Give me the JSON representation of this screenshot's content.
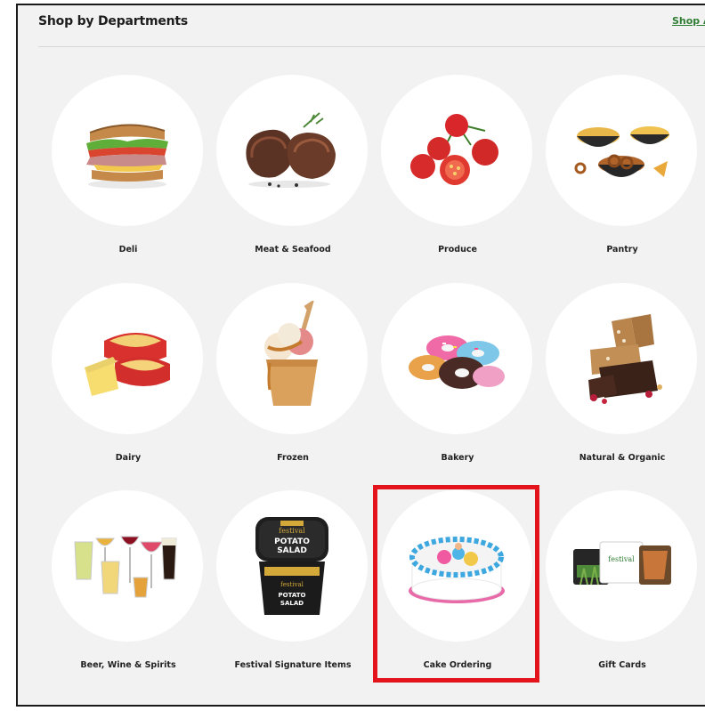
{
  "header": {
    "title": "Shop by Departments",
    "shop_all": "Shop All"
  },
  "departments": [
    {
      "label": "Deli",
      "icon": "sandwich-icon"
    },
    {
      "label": "Meat & Seafood",
      "icon": "steak-icon"
    },
    {
      "label": "Produce",
      "icon": "tomatoes-icon"
    },
    {
      "label": "Pantry",
      "icon": "snacks-icon"
    },
    {
      "label": "Dairy",
      "icon": "cheese-icon"
    },
    {
      "label": "Frozen",
      "icon": "ice-cream-icon"
    },
    {
      "label": "Bakery",
      "icon": "donuts-icon"
    },
    {
      "label": "Natural & Organic",
      "icon": "granola-bar-icon"
    },
    {
      "label": "Beer, Wine & Spirits",
      "icon": "glasses-icon"
    },
    {
      "label": "Festival Signature Items",
      "icon": "potato-salad-tub-icon",
      "image_text": [
        "festival",
        "POTATO",
        "SALAD",
        "POTATO",
        "SALAD"
      ]
    },
    {
      "label": "Cake Ordering",
      "icon": "cake-icon"
    },
    {
      "label": "Gift Cards",
      "icon": "gift-cards-icon",
      "image_text": [
        "festival"
      ]
    }
  ],
  "colors": {
    "accent_green": "#2f7d33",
    "highlight_red": "#e3141b",
    "panel_background": "#f2f2f2"
  }
}
